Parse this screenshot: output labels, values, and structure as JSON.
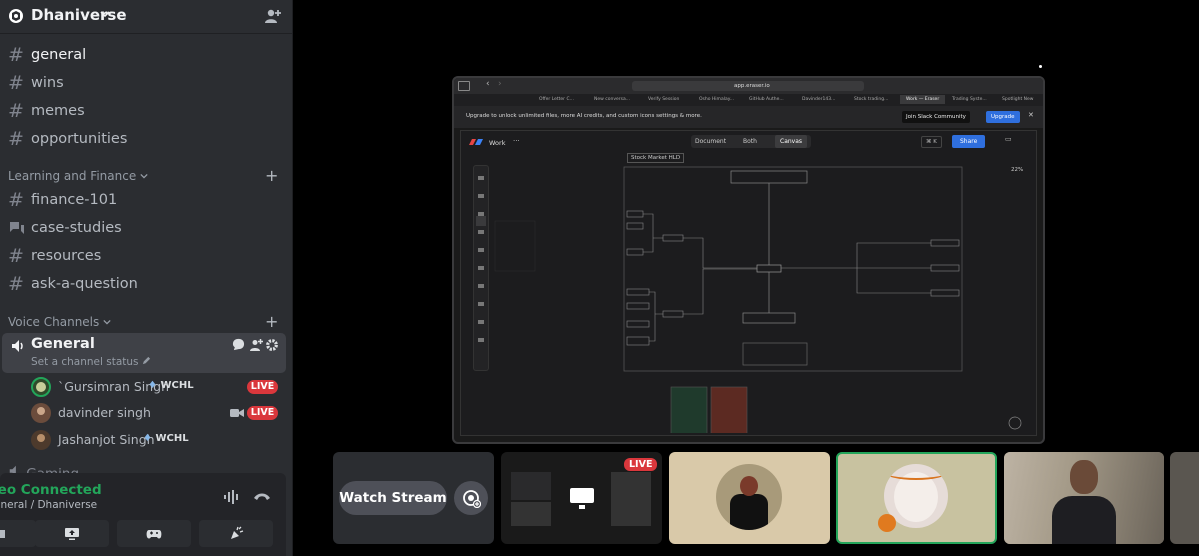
{
  "server": {
    "name": "Dhaniverse"
  },
  "text_channels": [
    {
      "name": "general",
      "active": true
    },
    {
      "name": "wins"
    },
    {
      "name": "memes"
    },
    {
      "name": "opportunities"
    }
  ],
  "categories": {
    "learning": "Learning and Finance",
    "voice": "Voice Channels"
  },
  "learning_channels": [
    {
      "name": "finance-101",
      "icon": "hash-icon"
    },
    {
      "name": "case-studies",
      "icon": "forum-icon"
    },
    {
      "name": "resources",
      "icon": "hash-icon"
    },
    {
      "name": "ask-a-question",
      "icon": "hash-icon"
    }
  ],
  "voice_channel": {
    "name": "General",
    "status": "Set a channel status",
    "users": [
      {
        "name": "`Gursimran Singh",
        "tag": "WCHL",
        "live": "LIVE",
        "avatar_color": "#7a8f5c"
      },
      {
        "name": "davinder singh",
        "live": "LIVE",
        "avatar_color": "#8a6a5a"
      },
      {
        "name": "Jashanjot Singh",
        "tag": "WCHL",
        "avatar_color": "#6b4e3d"
      }
    ]
  },
  "gaming_channel": "Gaming",
  "voice_connection": {
    "status": "deo Connected",
    "location": "eneral / Dhaniverse"
  },
  "stream": {
    "browser": {
      "url": "app.eraser.io",
      "tabs": [
        "Offer Letter C...",
        "New conversa...",
        "Verify Session",
        "Osho Himalay...",
        "GitHub Authe...",
        "Davinder143...",
        "Stock trading...",
        "Work — Eraser",
        "Trading Syste...",
        "Spotlight New"
      ],
      "banner": {
        "text": "Upgrade to unlock unlimited files, more AI credits, and custom icons settings & more.",
        "join_btn": "Join Slack Community",
        "upgrade_btn": "Upgrade"
      }
    },
    "eraser": {
      "workspace": "Work",
      "views": [
        "Document",
        "Both",
        "Canvas"
      ],
      "shortcut": "⌘ K",
      "share": "Share",
      "diagram_title": "Stock Market HLD",
      "zoom": "22%"
    }
  },
  "tiles": {
    "watch_label": "Watch Stream",
    "live": "LIVE"
  },
  "colors": {
    "live": "#da373c",
    "connected": "#23a55a",
    "upgrade": "#2f6fde",
    "share": "#2f6fde"
  }
}
